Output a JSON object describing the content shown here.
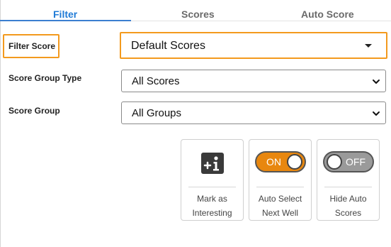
{
  "tabs": [
    {
      "label": "Filter",
      "active": true
    },
    {
      "label": "Scores",
      "active": false
    },
    {
      "label": "Auto Score",
      "active": false
    }
  ],
  "filter_score": {
    "label": "Filter Score",
    "value": "Default Scores"
  },
  "score_group_type": {
    "label": "Score Group Type",
    "value": "All Scores"
  },
  "score_group": {
    "label": "Score Group",
    "value": "All Groups"
  },
  "tiles": {
    "mark_interesting": {
      "icon": "plus-info-icon",
      "caption_line1": "Mark as",
      "caption_line2": "Interesting"
    },
    "auto_select": {
      "toggle_text": "ON",
      "toggle_state": "on",
      "caption_line1": "Auto Select",
      "caption_line2": "Next Well"
    },
    "hide_auto": {
      "toggle_text": "OFF",
      "toggle_state": "off",
      "caption_line1": "Hide Auto",
      "caption_line2": "Scores"
    }
  },
  "colors": {
    "accent_blue": "#1f7ad6",
    "highlight_orange": "#f39a1e",
    "toggle_on": "#e8870f",
    "toggle_off": "#9a9a9a"
  }
}
